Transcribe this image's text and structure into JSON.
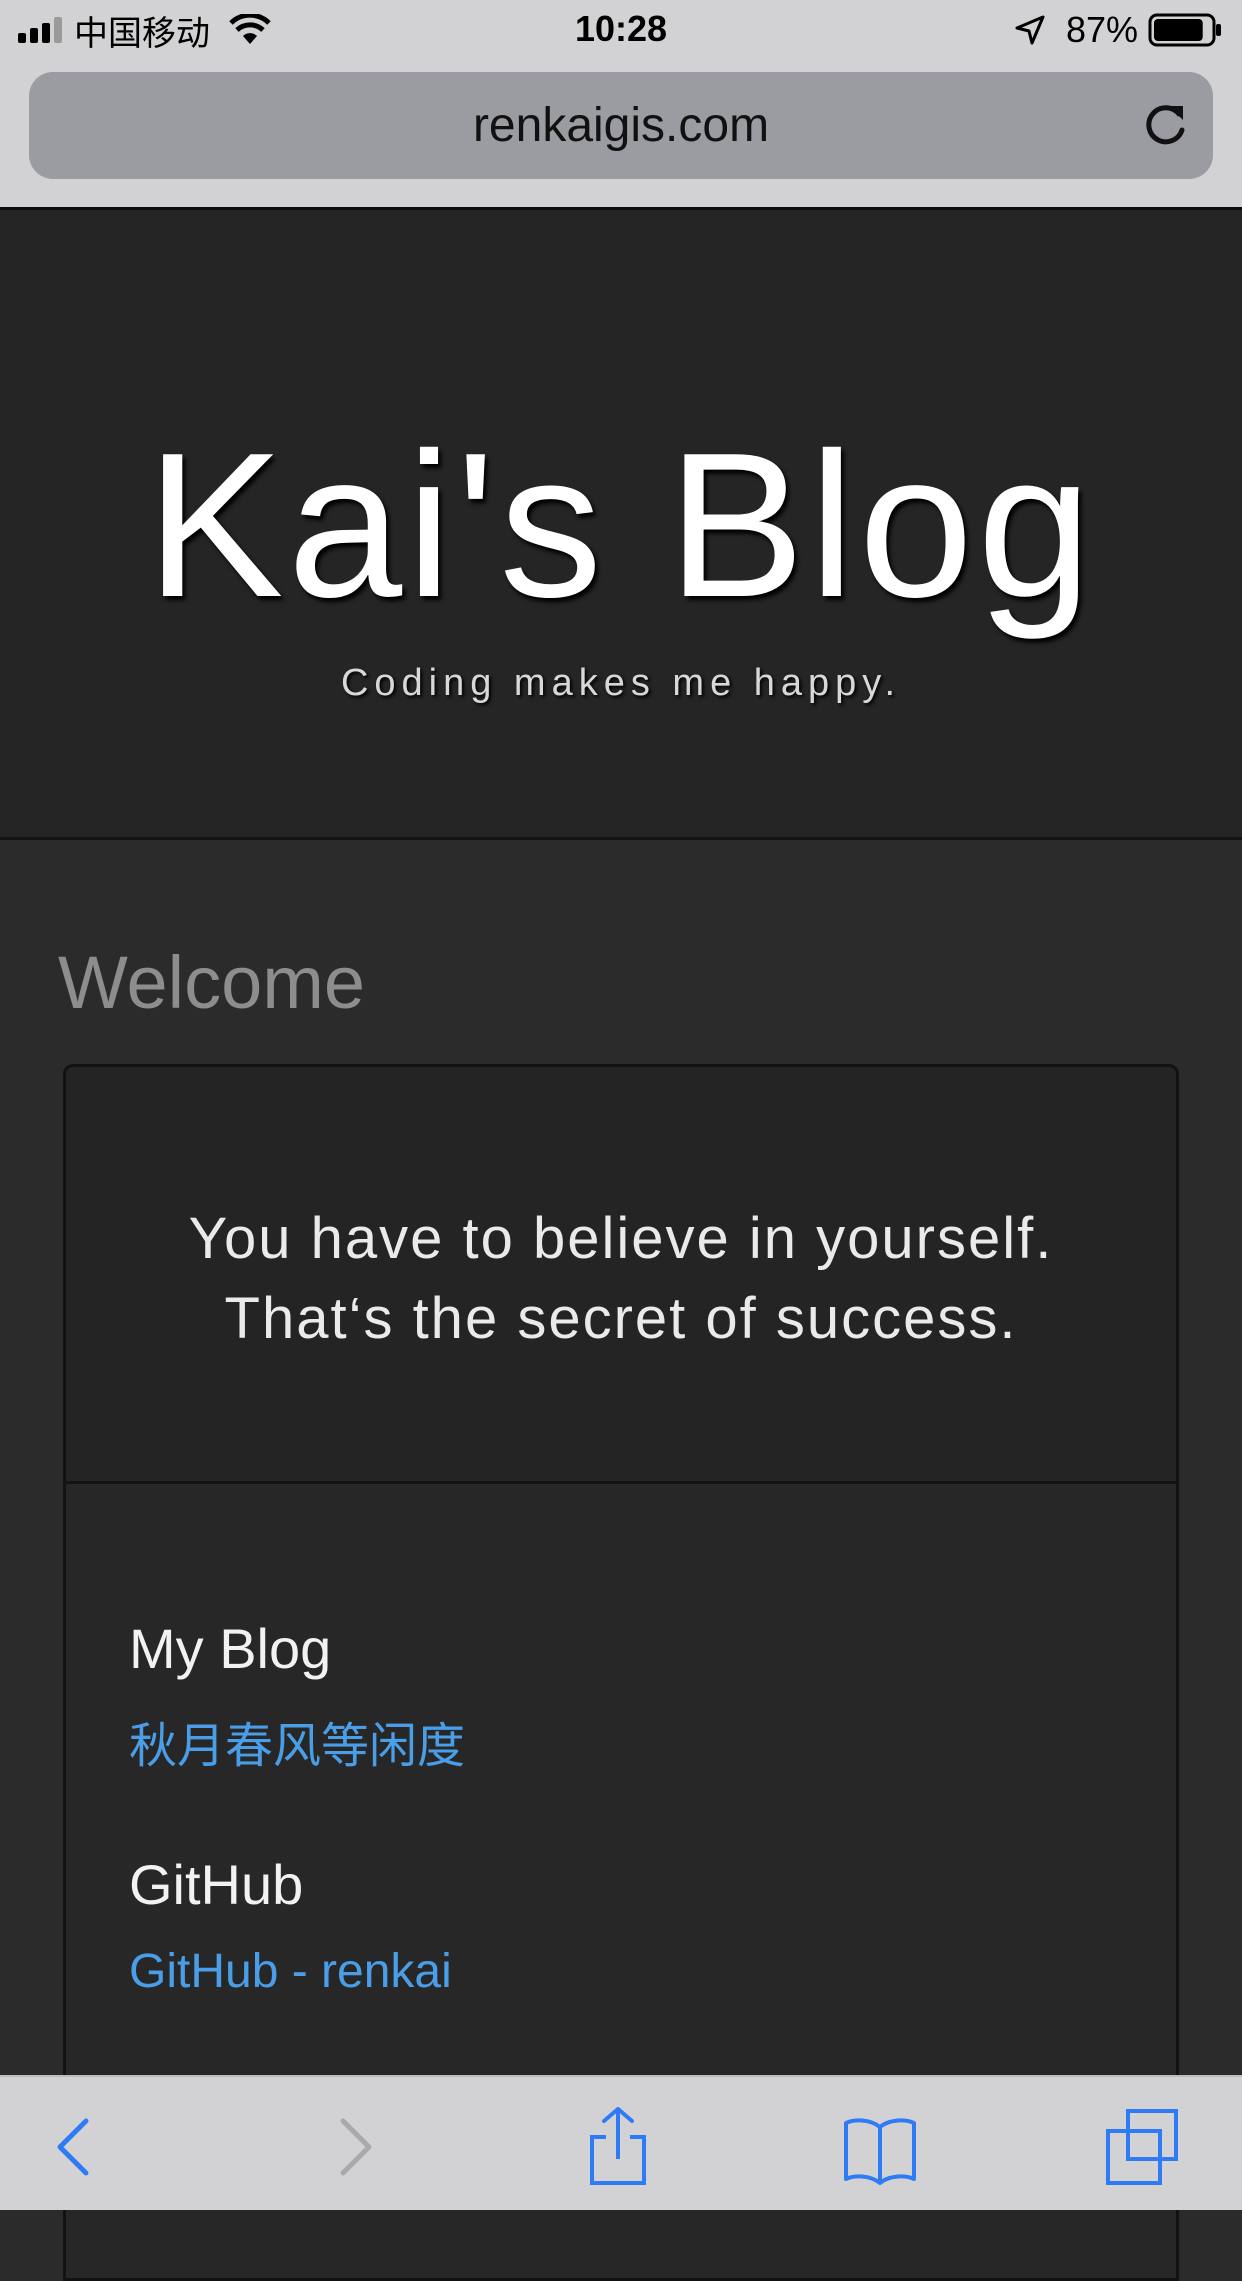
{
  "status_bar": {
    "carrier": "中国移动",
    "time": "10:28",
    "battery": "87%",
    "battery_level": 0.87,
    "icons": [
      "signal-icon",
      "wifi-icon",
      "location-icon",
      "battery-icon"
    ]
  },
  "browser": {
    "url": "renkaigis.com",
    "icons": [
      "reload-icon",
      "back-icon",
      "forward-icon",
      "share-icon",
      "bookmarks-icon",
      "tabs-icon"
    ]
  },
  "hero": {
    "title": "Kai's Blog",
    "subtitle": "Coding makes me happy."
  },
  "main": {
    "section_title": "Welcome",
    "quote_line1": "You have to believe in yourself.",
    "quote_line2": "That‘s the secret of success.",
    "links": [
      {
        "heading": "My Blog",
        "text": "秋月春风等闲度"
      },
      {
        "heading": "GitHub",
        "text": "GitHub - renkai"
      }
    ]
  },
  "colors": {
    "page_bg": "#2b2b2b",
    "hero_bg": "#252525",
    "link": "#4a9ee8",
    "chrome_bg": "#d2d2d4",
    "ios_blue": "#2f7bf6"
  }
}
